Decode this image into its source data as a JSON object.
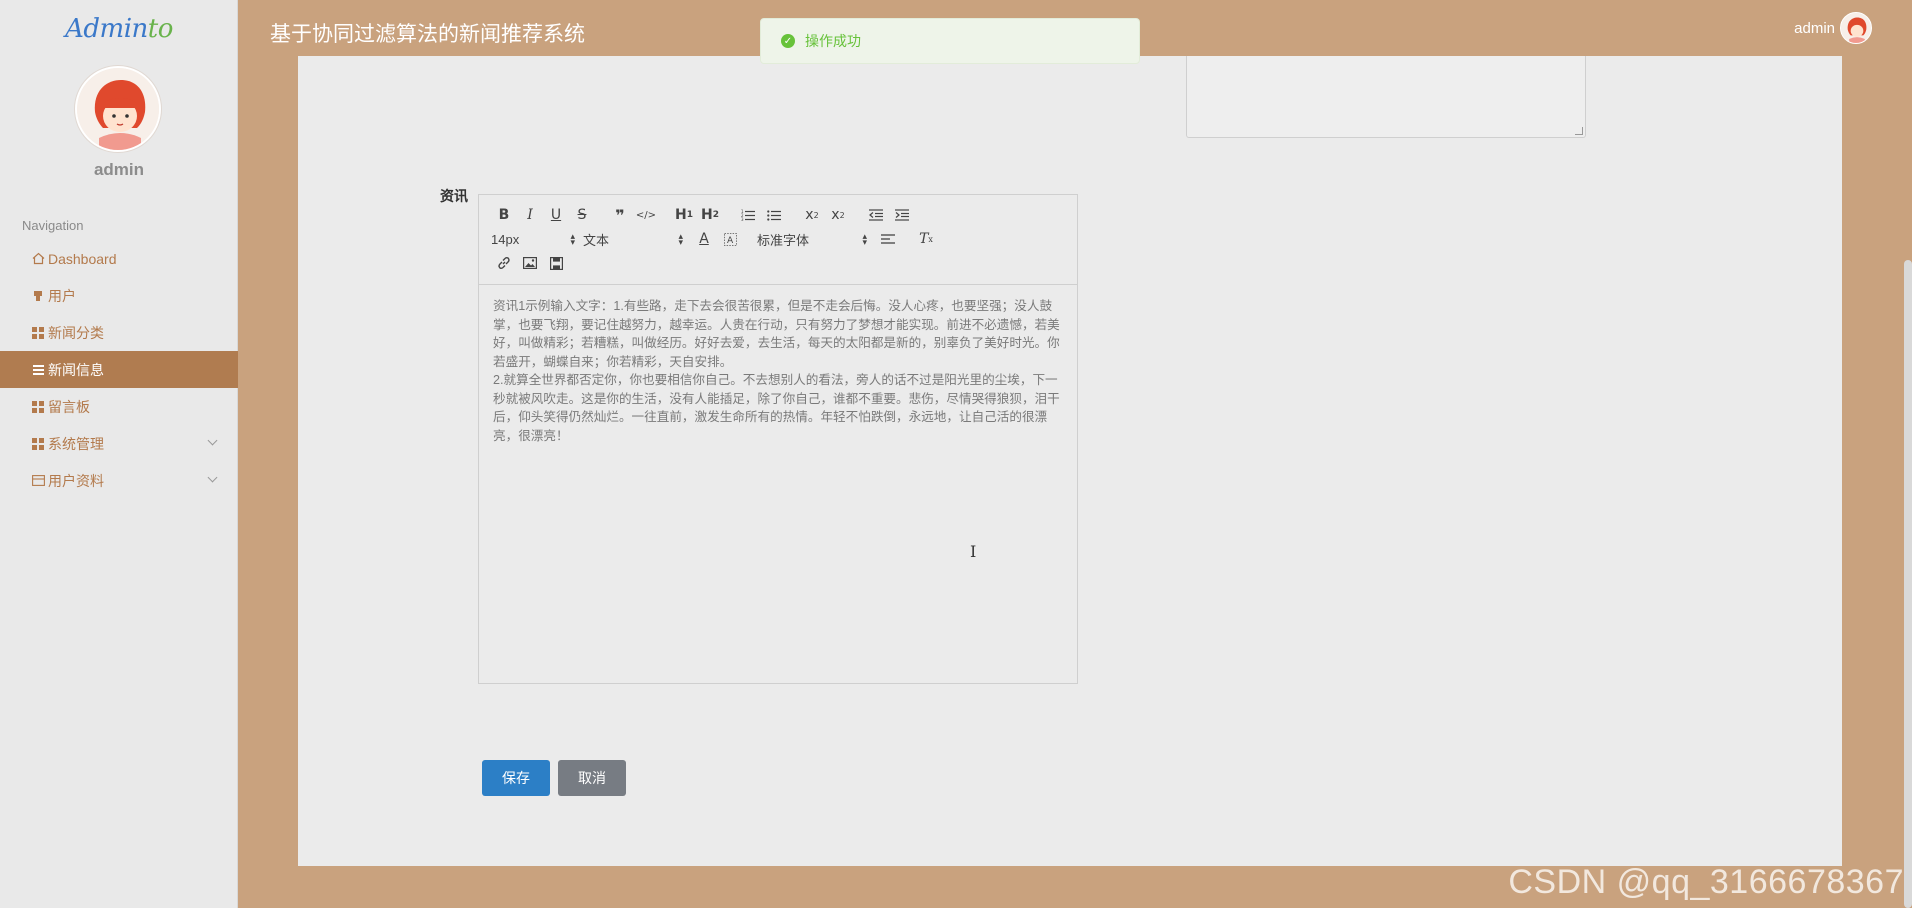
{
  "sidebar": {
    "logo": {
      "text_a": "Admin",
      "text_b": "to"
    },
    "username": "admin",
    "nav_title": "Navigation",
    "items": [
      {
        "label": "Dashboard",
        "icon": "home-icon"
      },
      {
        "label": "用户",
        "icon": "user-icon"
      },
      {
        "label": "新闻分类",
        "icon": "grid-icon"
      },
      {
        "label": "新闻信息",
        "icon": "list-icon",
        "active": true
      },
      {
        "label": "留言板",
        "icon": "grid-icon"
      },
      {
        "label": "系统管理",
        "icon": "grid-icon",
        "expandable": true
      },
      {
        "label": "用户资料",
        "icon": "card-icon",
        "expandable": true
      }
    ]
  },
  "header": {
    "title": "基于协同过滤算法的新闻推荐系统",
    "user": "admin"
  },
  "toast": {
    "message": "操作成功"
  },
  "form": {
    "field_label": "资讯",
    "toolbar": {
      "font_size": "14px",
      "header_select": "文本",
      "font_family": "标准字体"
    },
    "content": "资讯1示例输入文字：1.有些路，走下去会很苦很累，但是不走会后悔。没人心疼，也要坚强；没人鼓掌，也要飞翔，要记住越努力，越幸运。人贵在行动，只有努力了梦想才能实现。前进不必遗憾，若美好，叫做精彩；若糟糕，叫做经历。好好去爱，去生活，每天的太阳都是新的，别辜负了美好时光。你若盛开，蝴蝶自来；你若精彩，天自安排。\n2.就算全世界都否定你，你也要相信你自己。不去想别人的看法，旁人的话不过是阳光里的尘埃，下一秒就被风吹走。这是你的生活，没有人能插足，除了你自己，谁都不重要。悲伤，尽情哭得狼狈，泪干后，仰头笑得仍然灿烂。一往直前，激发生命所有的热情。年轻不怕跌倒，永远地，让自己活的很漂亮，很漂亮！",
    "save_label": "保存",
    "cancel_label": "取消"
  },
  "watermark": "CSDN @qq_3166678367",
  "colors": {
    "brand_bg": "#c9a27e",
    "active_nav": "#b07c50",
    "primary": "#2c7fc6",
    "success": "#67c23a"
  }
}
